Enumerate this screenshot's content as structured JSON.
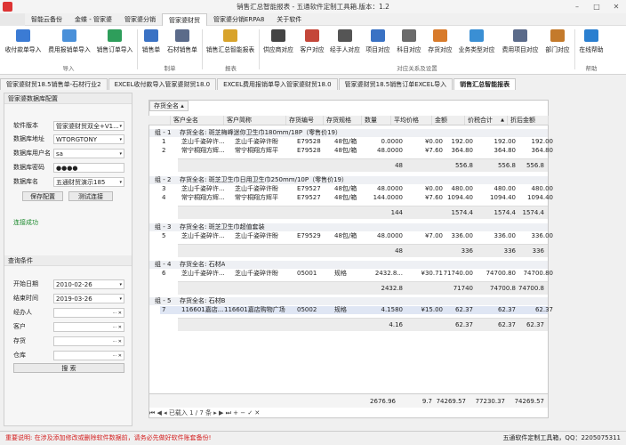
{
  "window": {
    "title": "销售汇总智能报表 - 五通软件定制工具箱.版本：1.2",
    "min": "–",
    "max": "□",
    "close": "✕"
  },
  "menu": {
    "tabs": [
      "智能云备份",
      "金蝶 - 管家婆",
      "管家婆分销",
      "管家婆财贸",
      "管家婆分销ERPA8",
      "关于软件"
    ],
    "active_index": 3
  },
  "ribbon": {
    "buttons": [
      {
        "label": "收付款单导入",
        "icon": "import-icon",
        "color": "#3b7bd4"
      },
      {
        "label": "费用报销单导入",
        "icon": "expense-icon",
        "color": "#4a90d9"
      },
      {
        "label": "销售订单导入",
        "icon": "order-import-icon",
        "color": "#2e9e5b"
      },
      {
        "label": "销售单",
        "icon": "sales-icon",
        "color": "#3a72c4"
      },
      {
        "label": "石材销售单",
        "icon": "stone-icon",
        "color": "#5b6b8a"
      },
      {
        "label": "销售汇总智能报表",
        "icon": "report-icon",
        "color": "#d8a32b"
      },
      {
        "label": "供应商对应",
        "icon": "supplier-icon",
        "color": "#444"
      },
      {
        "label": "客户对应",
        "icon": "customer-icon",
        "color": "#c4473a"
      },
      {
        "label": "经手人对应",
        "icon": "handler-icon",
        "color": "#555"
      },
      {
        "label": "项目对应",
        "icon": "project-icon",
        "color": "#3a72c4"
      },
      {
        "label": "科目对应",
        "icon": "subject-icon",
        "color": "#6b6b6b"
      },
      {
        "label": "存货对应",
        "icon": "inventory-icon",
        "color": "#d87b2b"
      },
      {
        "label": "业务类型对应",
        "icon": "biztype-icon",
        "color": "#3a8fd4"
      },
      {
        "label": "费用项目对应",
        "icon": "feeitem-icon",
        "color": "#5b6b8a"
      },
      {
        "label": "部门对应",
        "icon": "dept-icon",
        "color": "#c47a2b"
      },
      {
        "label": "在线帮助",
        "icon": "help-icon",
        "color": "#2a7fd0"
      }
    ],
    "groups": [
      "导入",
      "制单",
      "报表",
      "对应关系及设置",
      "帮助"
    ]
  },
  "doc_tabs": [
    "管家婆财贸18.5销售单-石材行业2",
    "EXCEL收付款导入管家婆财贸18.0",
    "EXCEL费用报销单导入管家婆财贸18.0",
    "管家婆财贸18.5销售订单EXCEL导入",
    "销售汇总智能报表"
  ],
  "left": {
    "db_header": "管家婆数据库配置",
    "fields": [
      {
        "label": "软件版本",
        "value": "管家婆财贸双全+V1...",
        "dd": "▾"
      },
      {
        "label": "数据库地址",
        "value": "WTORGTONY",
        "dd": "▾"
      },
      {
        "label": "数据库用户名",
        "value": "sa",
        "dd": "▾"
      },
      {
        "label": "数据库密码",
        "value": "●●●●",
        "dd": ""
      },
      {
        "label": "数据库名",
        "value": "五通财贸演示185",
        "dd": "▾"
      }
    ],
    "save_btn": "保存配置",
    "test_btn": "测试连接",
    "status": "连接成功",
    "query_header": "查询条件",
    "qfields": [
      {
        "label": "开始日期",
        "value": "2010-02-26",
        "dd": "▾"
      },
      {
        "label": "结束时间",
        "value": "2019-03-26",
        "dd": "▾"
      },
      {
        "label": "经办人",
        "value": "",
        "dd": "··· ✕"
      },
      {
        "label": "客户",
        "value": "",
        "dd": "··· ✕"
      },
      {
        "label": "存货",
        "value": "",
        "dd": "··· ✕"
      },
      {
        "label": "仓库",
        "value": "",
        "dd": "··· ✕"
      }
    ],
    "search_btn": "搜 索"
  },
  "grid": {
    "toolbar": "存货全名 ▴",
    "columns": [
      "客户全名",
      "客户简称",
      "存货编号",
      "存货规格",
      "数量",
      "平均价格",
      "金额",
      "价税合计",
      "折后金额"
    ],
    "sort_mark": "▲",
    "groups": [
      {
        "no": "组 - 1",
        "title": "存货全名: 斑芝梅峰迷你卫生巾180mm/18P（零售价19）",
        "rows": [
          {
            "n": "1",
            "c1": "芝山千姿碎许...",
            "c2": "芝山千姿碎许盼",
            "code": "E79528",
            "spec": "48包/箱",
            "qty": "0.0000",
            "avg": "¥0.00",
            "amt": "192.00",
            "tax": "192.00",
            "net": "192.00"
          },
          {
            "n": "2",
            "c1": "常宁桐翔方辉...",
            "c2": "常宁桐翔方辉平",
            "code": "E79528",
            "spec": "48包/箱",
            "qty": "48.0000",
            "avg": "¥7.60",
            "amt": "364.80",
            "tax": "364.80",
            "net": "364.80"
          }
        ],
        "sum": {
          "qty": "48",
          "amt": "556.8",
          "tax": "556.8",
          "net": "556.8"
        }
      },
      {
        "no": "组 - 2",
        "title": "存货全名: 斑芝卫生巾日用卫生巾250mm/10P（零售价19）",
        "rows": [
          {
            "n": "3",
            "c1": "芝山千姿碎许...",
            "c2": "芝山千姿碎许盼",
            "code": "E79527",
            "spec": "48包/箱",
            "qty": "48.0000",
            "avg": "¥0.00",
            "amt": "480.00",
            "tax": "480.00",
            "net": "480.00"
          },
          {
            "n": "4",
            "c1": "常宁桐翔方辉...",
            "c2": "常宁桐翔方辉平",
            "code": "E79527",
            "spec": "48包/箱",
            "qty": "144.0000",
            "avg": "¥7.60",
            "amt": "1094.40",
            "tax": "1094.40",
            "net": "1094.40"
          }
        ],
        "sum": {
          "qty": "144",
          "amt": "1574.4",
          "tax": "1574.4",
          "net": "1574.4"
        }
      },
      {
        "no": "组 - 3",
        "title": "存货全名: 斑芝卫生巾超值套装",
        "rows": [
          {
            "n": "5",
            "c1": "芝山千姿碎许...",
            "c2": "芝山千姿碎许盼",
            "code": "E79529",
            "spec": "48包/箱",
            "qty": "48.0000",
            "avg": "¥7.00",
            "amt": "336.00",
            "tax": "336.00",
            "net": "336.00"
          }
        ],
        "sum": {
          "qty": "48",
          "amt": "336",
          "tax": "336",
          "net": "336"
        }
      },
      {
        "no": "组 - 4",
        "title": "存货全名: 石材A",
        "rows": [
          {
            "n": "6",
            "c1": "芝山千姿碎许...",
            "c2": "芝山千姿碎许盼",
            "code": "05001",
            "spec": "规格",
            "qty": "2432.8...",
            "avg": "¥30.71",
            "amt": "71740.00",
            "tax": "74700.80",
            "net": "74700.80"
          }
        ],
        "sum": {
          "qty": "2432.8",
          "amt": "71740",
          "tax": "74700.8",
          "net": "74700.8"
        }
      },
      {
        "no": "组 - 5",
        "title": "存货全名: 石材B",
        "rows": [
          {
            "n": "7",
            "c1": "116601嘉店...",
            "c2": "116601嘉店购物广场",
            "code": "05002",
            "spec": "规格",
            "qty": "4.1580",
            "avg": "¥15.00",
            "amt": "62.37",
            "tax": "62.37",
            "net": "62.37"
          }
        ],
        "sum": {
          "qty": "4.16",
          "amt": "62.37",
          "tax": "62.37",
          "net": "62.37"
        }
      }
    ],
    "totals": {
      "qty": "2676.96",
      "avg": "9.7",
      "amt": "74269.57",
      "tax": "77230.37",
      "net": "74269.57"
    },
    "footer": "⏮ ◀ ◂ 已载入 1 / 7 条 ▸ ▶ ⏭ + − ✓ ✕"
  },
  "status": {
    "left": "重要说明: 在涉及添加修改或删除软件数据前，请务必先做好软件账套备份!",
    "right": "五通软件定制工具箱，QQ：2205075311",
    "left_color": "#d42020"
  }
}
